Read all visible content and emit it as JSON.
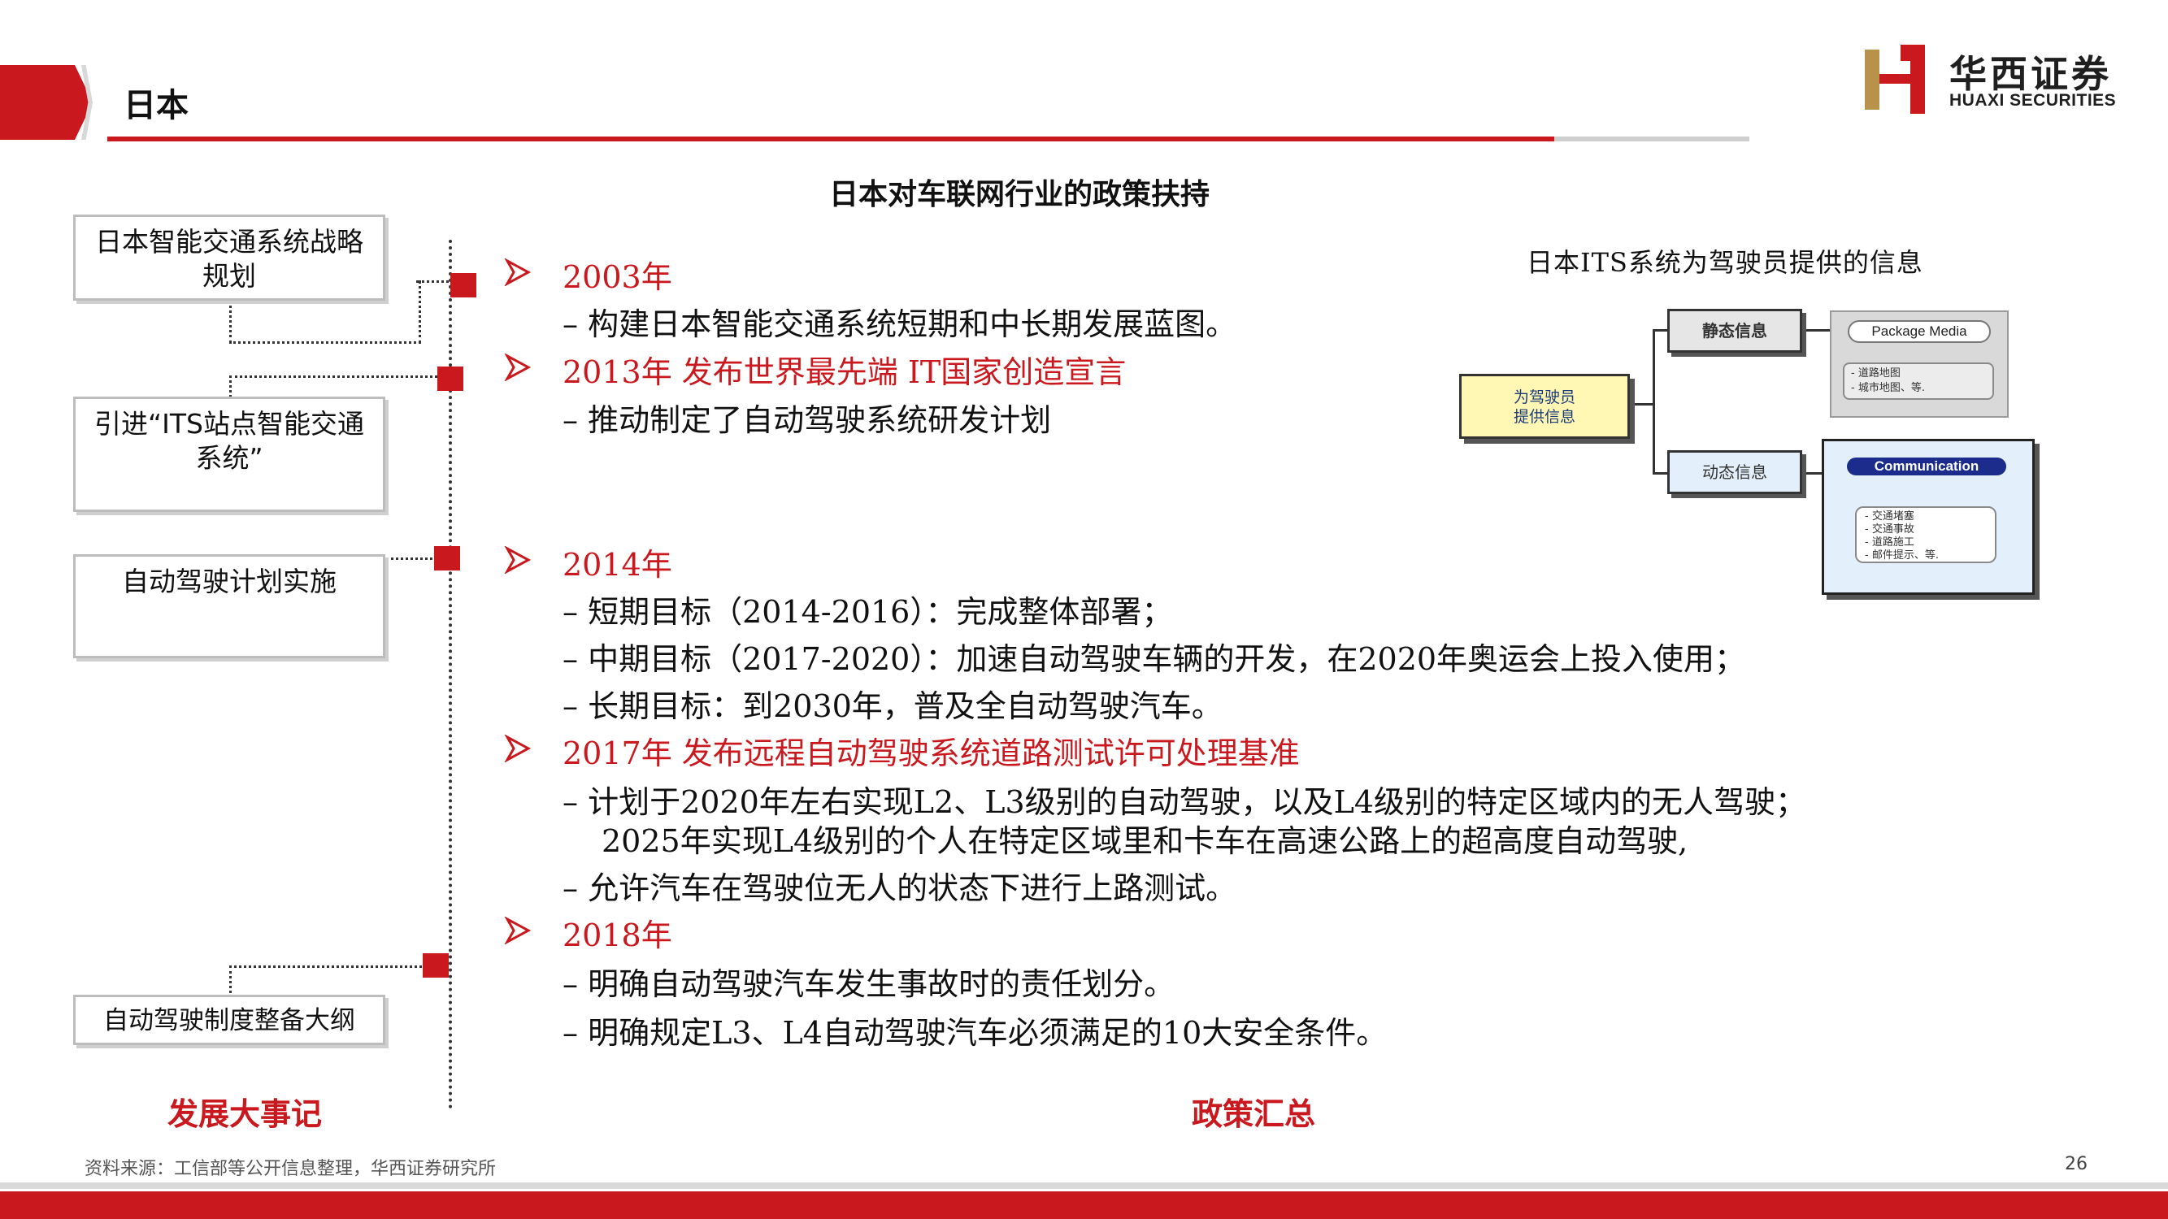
{
  "header": {
    "title": "日本",
    "logo_cn": "华西证券",
    "logo_en": "HUAXI SECURITIES"
  },
  "slide_title": "日本对车联网行业的政策扶持",
  "timeline": {
    "boxes": [
      "日本智能交通系统战略规划",
      "引进“ITS站点智能交通系统”",
      "自动驾驶计划实施",
      "自动驾驶制度整备大纲"
    ],
    "bottom_label": "发展大事记"
  },
  "policies": {
    "items": [
      {
        "year": "2003年",
        "bullets": [
          "构建日本智能交通系统短期和中长期发展蓝图。"
        ]
      },
      {
        "year": "2013年 发布世界最先端 IT国家创造宣言",
        "bullets": [
          "推动制定了自动驾驶系统研发计划"
        ]
      },
      {
        "year": "2014年",
        "bullets": [
          "短期目标（2014-2016）：完成整体部署；",
          "中期目标（2017-2020）：加速自动驾驶车辆的开发，在2020年奥运会上投入使用；",
          "长期目标：到2030年，普及全自动驾驶汽车。"
        ]
      },
      {
        "year": "2017年 发布远程自动驾驶系统道路测试许可处理基准",
        "bullets": [
          "计划于2020年左右实现L2、L3级别的自动驾驶，以及L4级别的特定区域内的无人驾驶；",
          "2025年实现L4级别的个人在特定区域里和卡车在高速公路上的超高度自动驾驶,",
          "允许汽车在驾驶位无人的状态下进行上路测试。"
        ]
      },
      {
        "year": "2018年",
        "bullets": [
          "明确自动驾驶汽车发生事故时的责任划分。",
          "明确规定L3、L4自动驾驶汽车必须满足的10大安全条件。"
        ]
      }
    ],
    "bottom_label": "政策汇总"
  },
  "its_diagram": {
    "caption": "日本ITS系统为驾驶员提供的信息",
    "root": [
      "为驾驶员",
      "提供信息"
    ],
    "static": {
      "label": "静态信息",
      "media_title": "Package Media",
      "media_items": [
        "- 道路地图",
        "- 城市地图、等."
      ]
    },
    "dynamic": {
      "label": "动态信息",
      "comm_title": "Communication",
      "comm_items": [
        "- 交通堵塞",
        "- 交通事故",
        "- 道路施工",
        "- 邮件提示、等."
      ]
    }
  },
  "footer": {
    "source": "资料来源：工信部等公开信息整理，华西证券研究所",
    "page": "26"
  },
  "colors": {
    "accent": "#c9191f",
    "gray": "#cfcfcf"
  }
}
